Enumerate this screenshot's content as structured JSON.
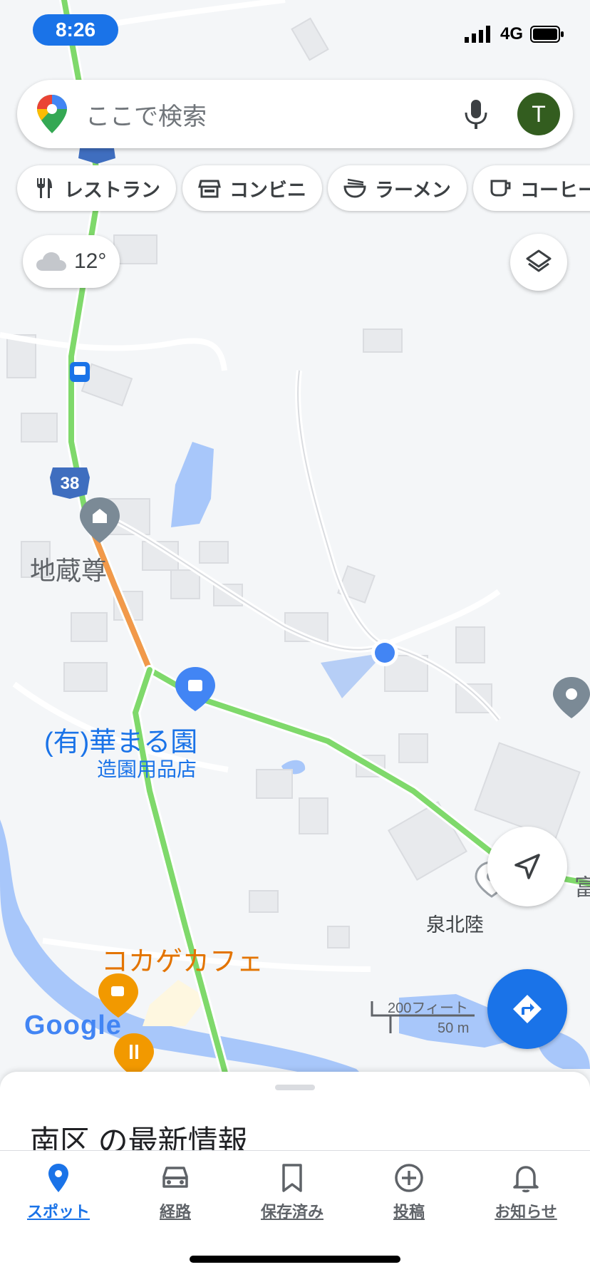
{
  "status_bar": {
    "time": "8:26",
    "network": "4G"
  },
  "search": {
    "placeholder": "ここで検索",
    "avatar_initial": "T"
  },
  "chips": [
    {
      "label": "レストラン",
      "icon": "fork-knife-icon"
    },
    {
      "label": "コンビニ",
      "icon": "store-icon"
    },
    {
      "label": "ラーメン",
      "icon": "ramen-icon"
    },
    {
      "label": "コーヒー",
      "icon": "coffee-cup-icon"
    }
  ],
  "weather": {
    "temp": "12°",
    "icon": "cloud-icon"
  },
  "map": {
    "route_shield": "38",
    "labels": {
      "jizo": "地蔵尊",
      "hanamaru": "(有)華まる園",
      "hanamaru_sub": "造園用品店",
      "cafe": "コカゲカフェ",
      "senboku": "泉北陸",
      "edge_label": "富"
    },
    "scale": {
      "feet": "200フィート",
      "meters": "50 m"
    },
    "brand": "Google"
  },
  "sheet": {
    "title": "南区 の最新情報"
  },
  "nav": [
    {
      "label": "スポット",
      "icon": "pin-icon",
      "active": true
    },
    {
      "label": "経路",
      "icon": "car-icon",
      "active": false
    },
    {
      "label": "保存済み",
      "icon": "bookmark-icon",
      "active": false
    },
    {
      "label": "投稿",
      "icon": "plus-circle-icon",
      "active": false
    },
    {
      "label": "お知らせ",
      "icon": "bell-icon",
      "active": false
    }
  ],
  "colors": {
    "accent": "#1a73e8",
    "route_green": "#7fd96b",
    "route_orange": "#f2994a",
    "water": "#a8c7fa",
    "avatar": "#335d1f"
  }
}
